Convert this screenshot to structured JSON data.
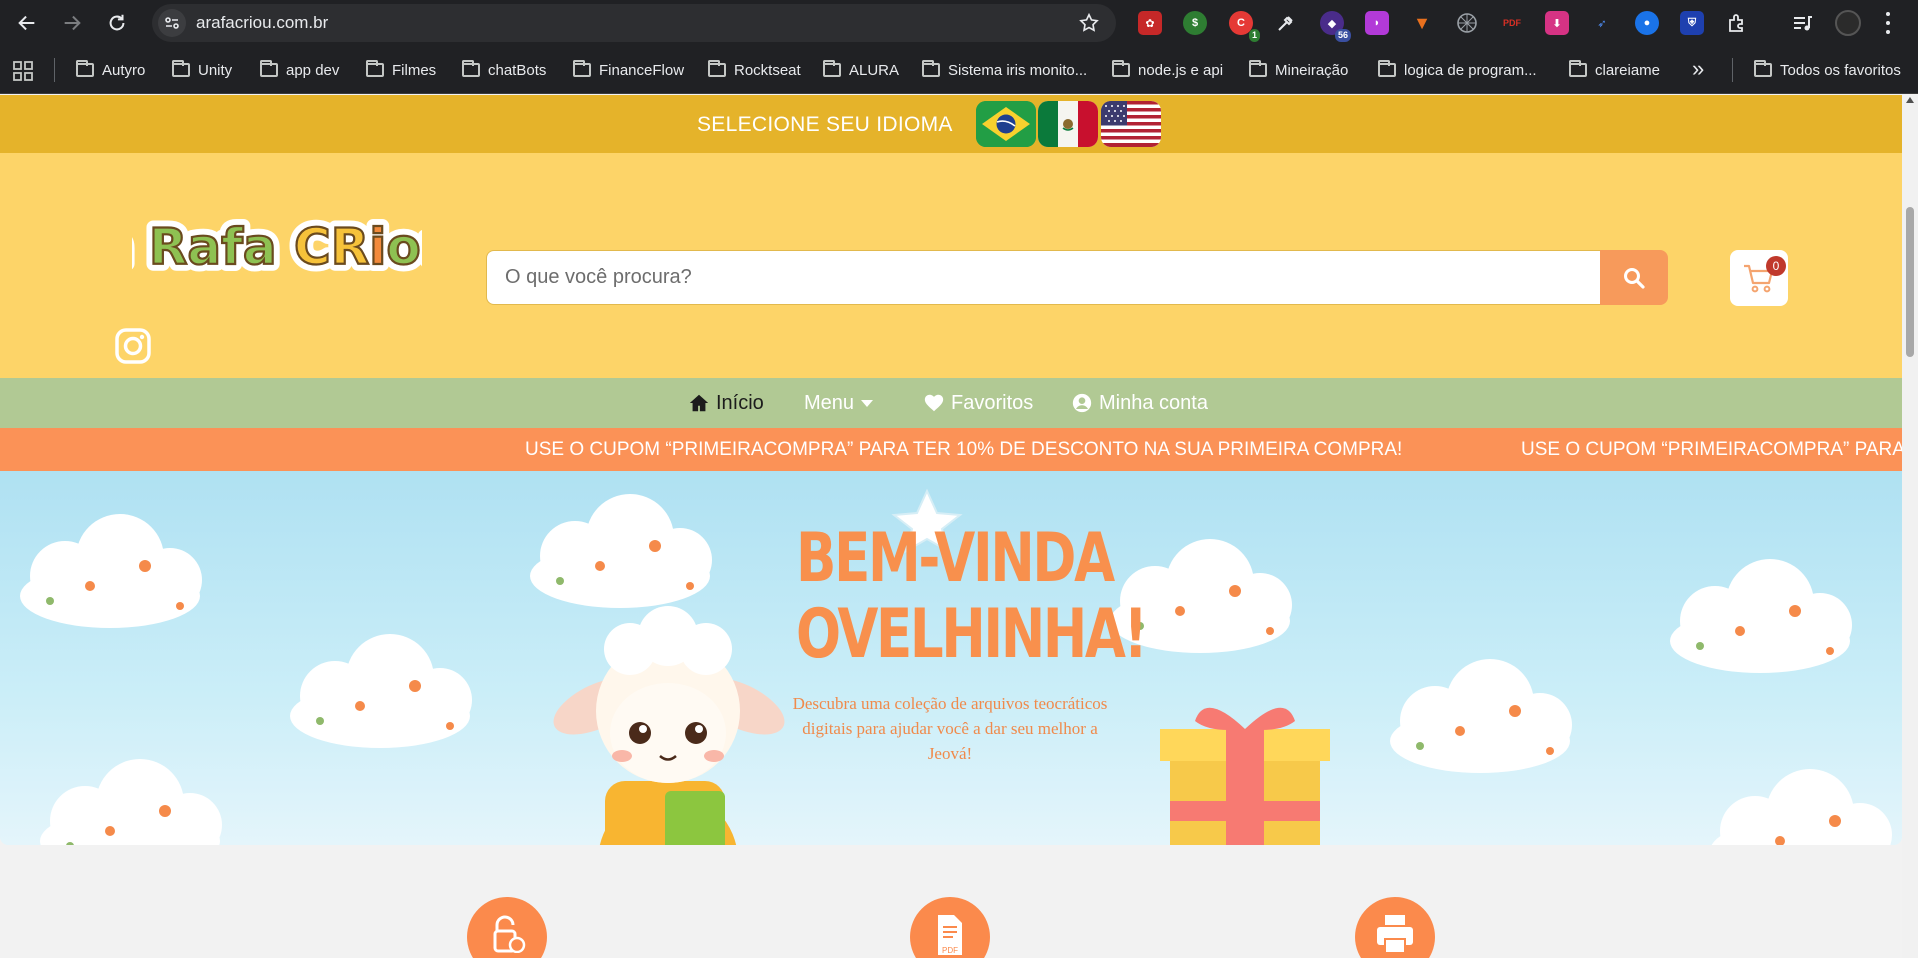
{
  "browser": {
    "url": "arafacriou.com.br",
    "bookmarks": [
      "Autyro",
      "Unity",
      "app dev",
      "Filmes",
      "chatBots",
      "FinanceFlow",
      "Rocktseat",
      "ALURA",
      "Sistema iris monito...",
      "node.js e api",
      "Mineiração",
      "logica de program...",
      "clareiame"
    ],
    "all_bookmarks": "Todos os favoritos",
    "extension_badges": {
      "badge_1": "1",
      "badge_56": "56"
    }
  },
  "site": {
    "lang_label": "SELECIONE SEU IDIOMA",
    "logo_text": "a Rafa CRiou",
    "search_placeholder": "O que você procura?",
    "cart_count": "0",
    "nav": {
      "home": "Início",
      "menu": "Menu",
      "favorites": "Favoritos",
      "account": "Minha conta"
    },
    "promo": "USE O CUPOM “PRIMEIRACOMPRA” PARA TER 10% DE DESCONTO NA SUA PRIMEIRA COMPRA!",
    "promo_repeat": "USE O CUPOM “PRIMEIRACOMPRA” PARA",
    "hero": {
      "title_line1": "BEM-VINDA",
      "title_line2": "OVELHINHA!",
      "subtitle": "Descubra uma coleção de arquivos teocráticos digitais para ajudar você a dar seu melhor a Jeová!"
    },
    "feature_icon_pdf": "PDF"
  },
  "colors": {
    "lang_bar": "#e5b32a",
    "header": "#fdd468",
    "nav_bar": "#b1c994",
    "promo": "#fb9257",
    "accent": "#f8904d"
  }
}
